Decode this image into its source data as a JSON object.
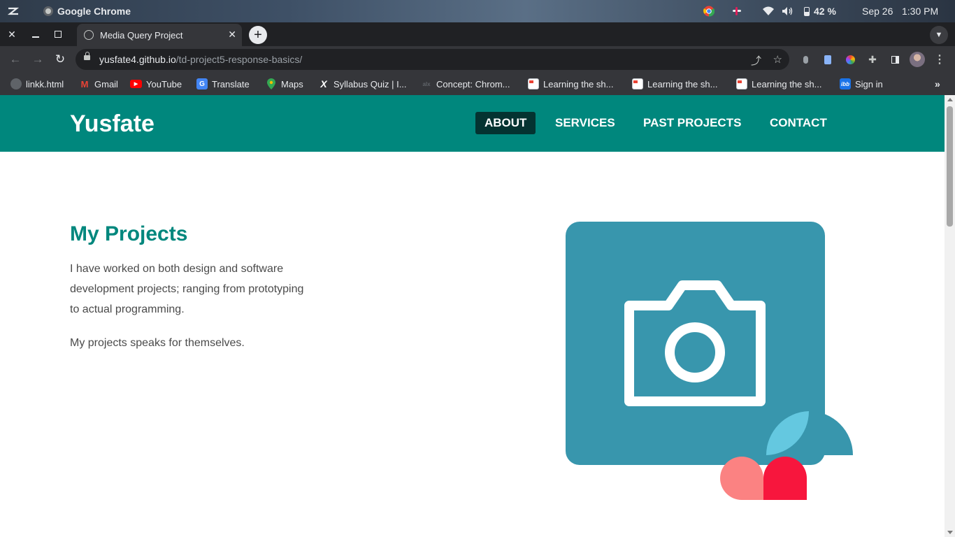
{
  "os": {
    "app_name": "Google Chrome",
    "battery": "42 %",
    "date": "Sep 26",
    "time": "1:30 PM"
  },
  "browser": {
    "tab_title": "Media Query Project",
    "url_host": "yusfate4.github.io",
    "url_path": "/td-project5-response-basics/",
    "bookmarks": [
      {
        "label": "linkk.html",
        "icon": "globe-icon"
      },
      {
        "label": "Gmail",
        "icon": "gmail-icon"
      },
      {
        "label": "YouTube",
        "icon": "youtube-icon"
      },
      {
        "label": "Translate",
        "icon": "translate-icon"
      },
      {
        "label": "Maps",
        "icon": "maps-icon"
      },
      {
        "label": "Syllabus Quiz | I...",
        "icon": "x-icon"
      },
      {
        "label": "Concept: Chrom...",
        "icon": "alx-icon"
      },
      {
        "label": "Learning the sh...",
        "icon": "doc-icon"
      },
      {
        "label": "Learning the sh...",
        "icon": "doc-icon"
      },
      {
        "label": "Learning the sh...",
        "icon": "doc-icon"
      },
      {
        "label": "Sign in",
        "icon": "ibb-icon"
      }
    ]
  },
  "site": {
    "brand": "Yusfate",
    "nav": [
      "ABOUT",
      "SERVICES",
      "PAST PROJECTS",
      "CONTACT"
    ],
    "active_nav": "ABOUT",
    "heading": "My Projects",
    "paragraph1": "I have worked on both design and software development projects; ranging from prototyping to actual programming.",
    "paragraph2": "My projects speaks for themselves.",
    "colors": {
      "header": "#00877d",
      "active_nav": "#043331",
      "heading": "#00877d",
      "hero_box": "#3896ad",
      "leaf_light": "#64c8e0",
      "drop_pink": "#fb8282",
      "drop_red": "#f7163d"
    }
  }
}
